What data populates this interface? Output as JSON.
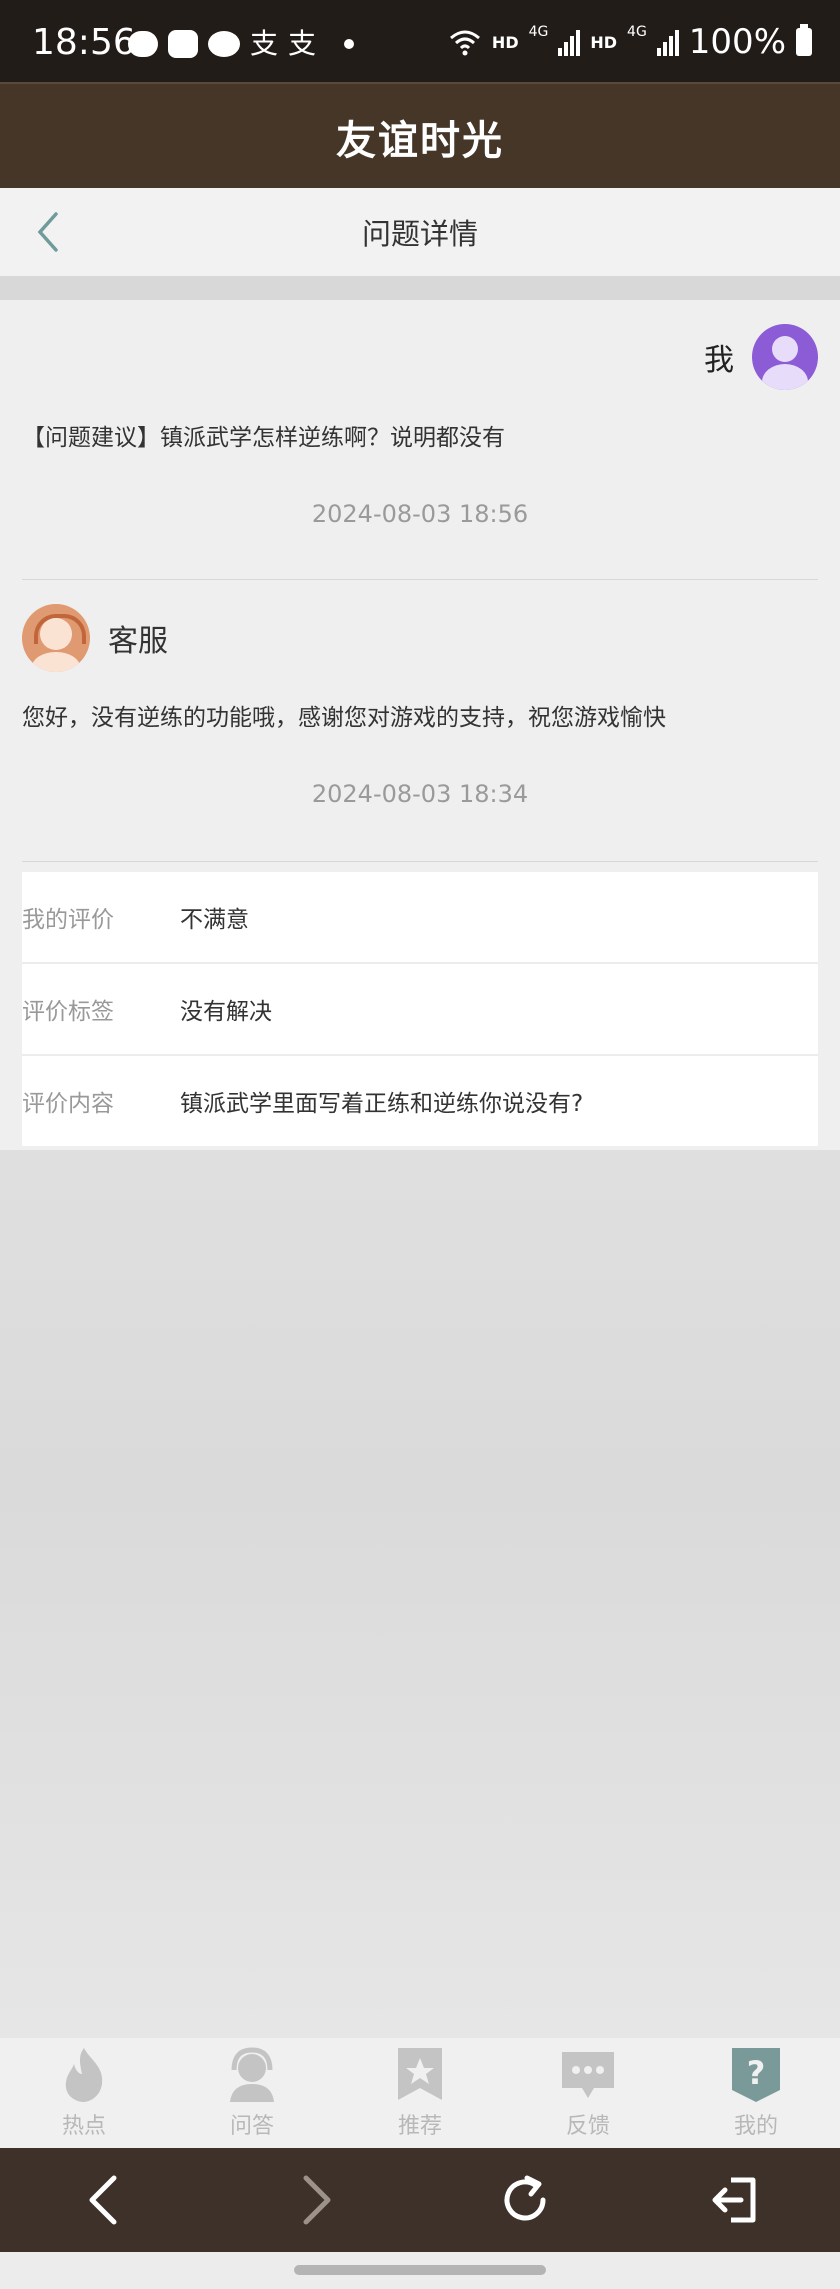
{
  "status_bar": {
    "time": "18:56",
    "notification_icons": [
      "message-icon",
      "check-icon",
      "wechat-icon",
      "alipay-icon",
      "alipay-icon",
      "dot-icon"
    ],
    "ali_glyph": "支",
    "hd1": "HD",
    "net1": "4G",
    "hd2": "HD",
    "net2": "4G",
    "battery": "100%"
  },
  "header": {
    "title": "友谊时光"
  },
  "sub_header": {
    "title": "问题详情",
    "back_icon": "chevron-left-icon"
  },
  "thread": {
    "me_label": "我",
    "question": "【问题建议】镇派武学怎样逆练啊？说明都没有",
    "question_time": "2024-08-03 18:56",
    "cs_label": "客服",
    "answer": "您好，没有逆练的功能哦，感谢您对游戏的支持，祝您游戏愉快",
    "answer_time": "2024-08-03 18:34"
  },
  "evaluation": [
    {
      "key": "我的评价",
      "value": "不满意"
    },
    {
      "key": "评价标签",
      "value": "没有解决"
    },
    {
      "key": "评价内容",
      "value": "镇派武学里面写着正练和逆练你说没有?"
    }
  ],
  "bottom_nav": [
    {
      "label": "热点",
      "icon": "fire-icon"
    },
    {
      "label": "问答",
      "icon": "headset-icon"
    },
    {
      "label": "推荐",
      "icon": "star-bookmark-icon"
    },
    {
      "label": "反馈",
      "icon": "chat-bubble-icon"
    },
    {
      "label": "我的",
      "icon": "question-shield-icon"
    }
  ],
  "browser_bar": [
    "back-arrow-icon",
    "forward-arrow-icon",
    "refresh-icon",
    "exit-icon"
  ],
  "colors": {
    "status_bg": "#221c19",
    "header_bg": "#463628",
    "browser_bar_bg": "#3d3129",
    "me_avatar": "#8c5bd6",
    "cs_avatar": "#e09a72",
    "nav_inactive": "#b8b8b8",
    "nav_active": "#6f8e8f"
  }
}
